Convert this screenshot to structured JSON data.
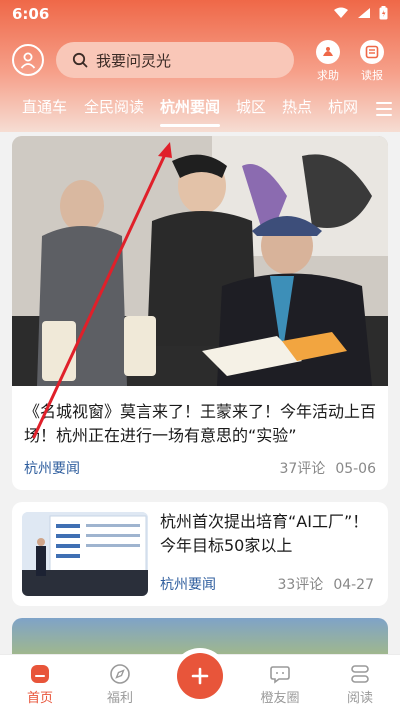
{
  "status_bar": {
    "time": "6:06"
  },
  "header": {
    "search_placeholder": "我要问灵光",
    "actions": [
      {
        "label": "求助",
        "icon": "help-icon"
      },
      {
        "label": "读报",
        "icon": "newspaper-icon"
      }
    ]
  },
  "tabs": {
    "items": [
      "直通车",
      "全民阅读",
      "杭州要闻",
      "城区",
      "热点",
      "杭网"
    ],
    "active_index": 2
  },
  "feed": {
    "items": [
      {
        "title": "《名城视窗》莫言来了！王蒙来了！今年活动上百场！杭州正在进行一场有意思的“实验”",
        "tag": "杭州要闻",
        "comments": "37评论",
        "date": "05-06"
      },
      {
        "title": "杭州首次提出培育“AI工厂”！今年目标50家以上",
        "tag": "杭州要闻",
        "comments": "33评论",
        "date": "04-27"
      }
    ]
  },
  "bottom_nav": {
    "items": [
      {
        "label": "首页",
        "icon": "home-icon"
      },
      {
        "label": "福利",
        "icon": "compass-icon"
      },
      {
        "label": "",
        "icon": "plus-icon"
      },
      {
        "label": "橙友圈",
        "icon": "chat-icon"
      },
      {
        "label": "阅读",
        "icon": "reading-icon"
      }
    ],
    "active_index": 0
  },
  "colors": {
    "accent": "#e8553a",
    "tag_blue": "#2f5e9e",
    "annotation_arrow": "#e0202a"
  }
}
